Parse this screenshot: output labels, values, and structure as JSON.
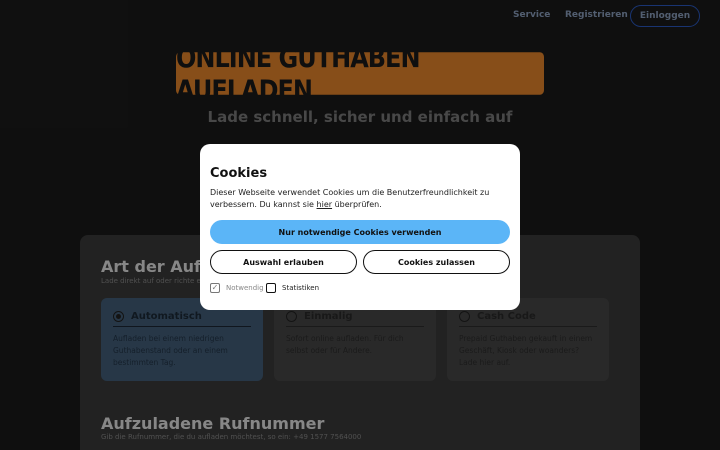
{
  "nav": {
    "service": "Service",
    "register": "Registrieren",
    "login": "Einloggen"
  },
  "hero": {
    "title": "ONLINE GUTHABEN AUFLADEN",
    "subtitle": "Lade schnell, sicher und einfach auf"
  },
  "main": {
    "type_section": {
      "title": "Art der Aufladung",
      "hint": "Lade direkt auf oder richte eine automatische Aufladung ein."
    },
    "options": [
      {
        "label": "Automatisch",
        "desc": "Aufladen bei einem niedrigen Guthabenstand oder an einem bestimmten Tag.",
        "selected": true
      },
      {
        "label": "Einmalig",
        "desc": "Sofort online aufladen. Für dich selbst oder für Andere.",
        "selected": false
      },
      {
        "label": "Cash Code",
        "desc": "Prepaid Guthaben gekauft in einem Geschäft, Kiosk oder woanders? Lade hier auf.",
        "selected": false
      }
    ],
    "number_section": {
      "title": "Aufzuladene Rufnummer",
      "hint": "Gib die Rufnummer, die du aufladen möchtest, so ein: +49 1577 7564000"
    }
  },
  "cookies": {
    "title": "Cookies",
    "text_before": "Dieser Webseite verwendet Cookies um die Benutzerfreundlichkeit zu verbessern. Du kannst sie ",
    "link": "hier",
    "text_after": " überprüfen.",
    "btn_necessary": "Nur notwendige Cookies verwenden",
    "btn_selection": "Auswahl erlauben",
    "btn_all": "Cookies zulassen",
    "check_necessary": "Notwendig",
    "check_stats": "Statistiken"
  },
  "colors": {
    "accent_orange": "#e8872c",
    "primary_blue": "#5bb5f7",
    "nav_border": "#2b5bc4"
  }
}
